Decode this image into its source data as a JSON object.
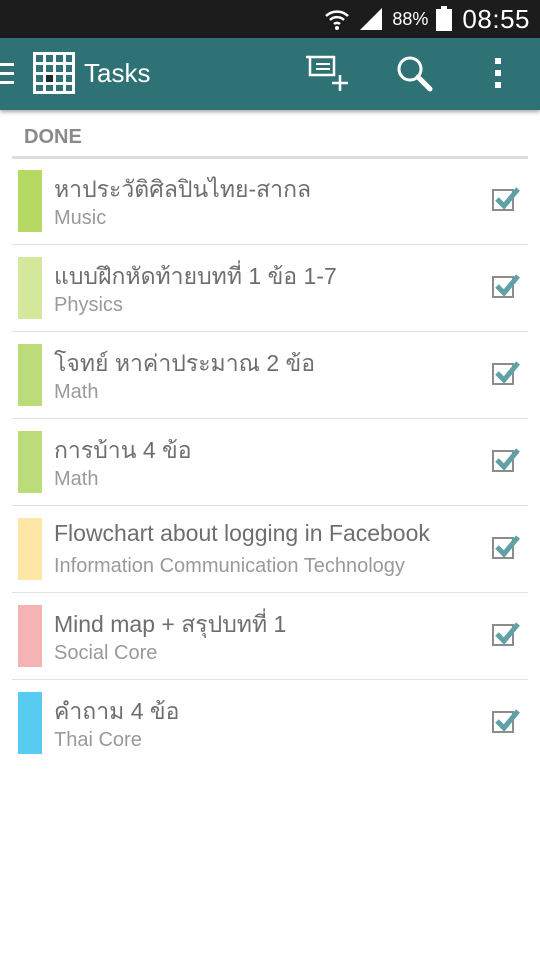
{
  "status_bar": {
    "battery_percent": "88%",
    "time": "08:55",
    "icons": [
      "wifi-icon",
      "signal-icon",
      "battery-icon"
    ]
  },
  "app_bar": {
    "title": "Tasks",
    "icons": [
      "menu-icon",
      "app-logo-icon",
      "add-list-icon",
      "search-icon",
      "overflow-menu-icon"
    ],
    "color": "#2e7275"
  },
  "section": {
    "label": "DONE"
  },
  "tasks": [
    {
      "title": "หาประวัติศิลปินไทย-สากล",
      "subject": "Music",
      "color": "#b5d963",
      "checked": true
    },
    {
      "title": "แบบฝึกหัดท้ายบทที่ 1 ข้อ 1-7",
      "subject": "Physics",
      "color": "#d3e89a",
      "checked": true
    },
    {
      "title": "โจทย์ หาค่าประมาณ 2 ข้อ",
      "subject": "Math",
      "color": "#bcdb7a",
      "checked": true
    },
    {
      "title": "การบ้าน 4 ข้อ",
      "subject": "Math",
      "color": "#bcdb7a",
      "checked": true
    },
    {
      "title": "Flowchart about logging in Facebook",
      "subject": "Information Communication Technology",
      "color": "#fde6a6",
      "checked": true
    },
    {
      "title": "Mind map + สรุปบทที่ 1",
      "subject": "Social Core",
      "color": "#f6b3b3",
      "checked": true
    },
    {
      "title": "คำถาม 4 ข้อ",
      "subject": "Thai Core",
      "color": "#58ccf0",
      "checked": true
    }
  ]
}
